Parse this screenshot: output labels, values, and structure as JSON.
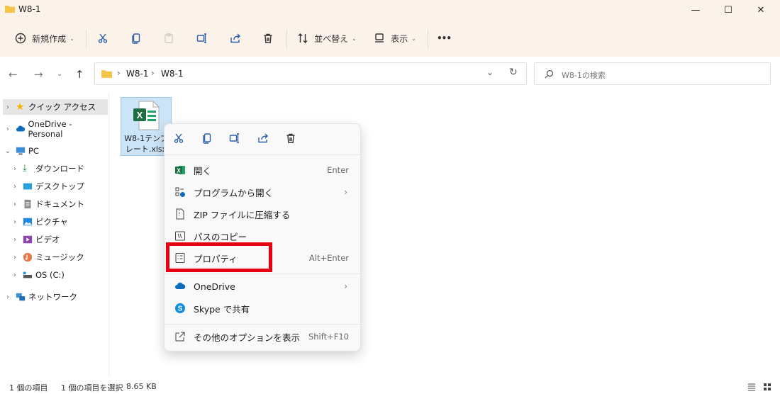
{
  "window": {
    "title": "W8-1",
    "minimize": "—",
    "maximize": "☐",
    "close": "✕"
  },
  "toolbar": {
    "new_label": "新規作成",
    "sort_label": "並べ替え",
    "view_label": "表示",
    "more": "•••"
  },
  "address": {
    "crumbs": [
      "W8-1",
      "W8-1"
    ],
    "search_placeholder": "W8-1の検索"
  },
  "sidebar": {
    "items": [
      {
        "label": "クイック アクセス"
      },
      {
        "label": "OneDrive - Personal"
      },
      {
        "label": "PC"
      },
      {
        "label": "ダウンロード"
      },
      {
        "label": "デスクトップ"
      },
      {
        "label": "ドキュメント"
      },
      {
        "label": "ピクチャ"
      },
      {
        "label": "ビデオ"
      },
      {
        "label": "ミュージック"
      },
      {
        "label": "OS (C:)"
      },
      {
        "label": "ネットワーク"
      }
    ]
  },
  "file": {
    "name_line1": "W8-1テンプ",
    "name_line2": "レート.xlsx"
  },
  "context_menu": {
    "items": [
      {
        "label": "開く",
        "shortcut": "Enter"
      },
      {
        "label": "プログラムから開く"
      },
      {
        "label": "ZIP ファイルに圧縮する"
      },
      {
        "label": "パスのコピー"
      },
      {
        "label": "プロパティ",
        "shortcut": "Alt+Enter"
      },
      {
        "label": "OneDrive"
      },
      {
        "label": "Skype で共有"
      },
      {
        "label": "その他のオプションを表示",
        "shortcut": "Shift+F10"
      }
    ]
  },
  "status": {
    "count": "1 個の項目",
    "selected": "1 個の項目を選択",
    "size": "8.65 KB"
  },
  "colors": {
    "highlight": "#e60012",
    "accent": "#2d5ea8",
    "excel": "#1d6f42"
  }
}
